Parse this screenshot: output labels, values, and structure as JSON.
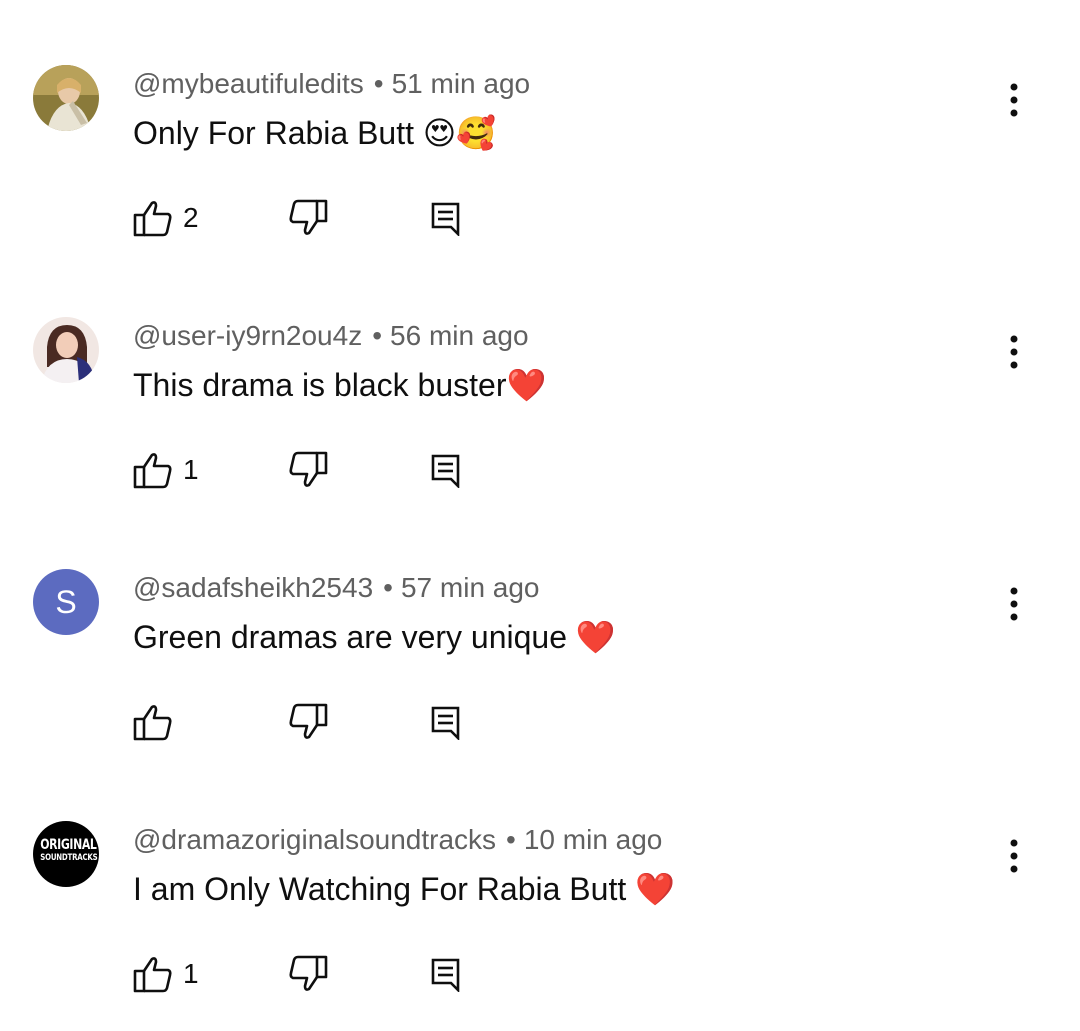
{
  "comments": [
    {
      "author": "@mybeautifuledits",
      "separator": "•",
      "time": "51 min ago",
      "text": "Only For Rabia Butt 😍🥰",
      "likes": "2",
      "avatar": {
        "type": "photo",
        "icon": "user-avatar-photo"
      }
    },
    {
      "author": "@user-iy9rn2ou4z",
      "separator": "•",
      "time": "56 min ago",
      "text": "This drama is black buster❤️",
      "likes": "1",
      "avatar": {
        "type": "photo",
        "icon": "user-avatar-photo"
      }
    },
    {
      "author": "@sadafsheikh2543",
      "separator": "•",
      "time": "57 min ago",
      "text": "Green dramas are very unique ❤️",
      "likes": "",
      "avatar": {
        "type": "letter",
        "letter": "S",
        "color": "#5c6bc0"
      }
    },
    {
      "author": "@dramazoriginalsoundtracks",
      "separator": "•",
      "time": "10 min ago",
      "text": "I am Only Watching For Rabia Butt ❤️",
      "likes": "1",
      "avatar": {
        "type": "logo",
        "line1": "ORIGINAL",
        "line2": "SOUNDTRACKS"
      }
    }
  ],
  "icons": {
    "like": "thumbs-up-icon",
    "dislike": "thumbs-down-icon",
    "reply": "reply-comment-icon",
    "more": "more-vertical-icon"
  }
}
